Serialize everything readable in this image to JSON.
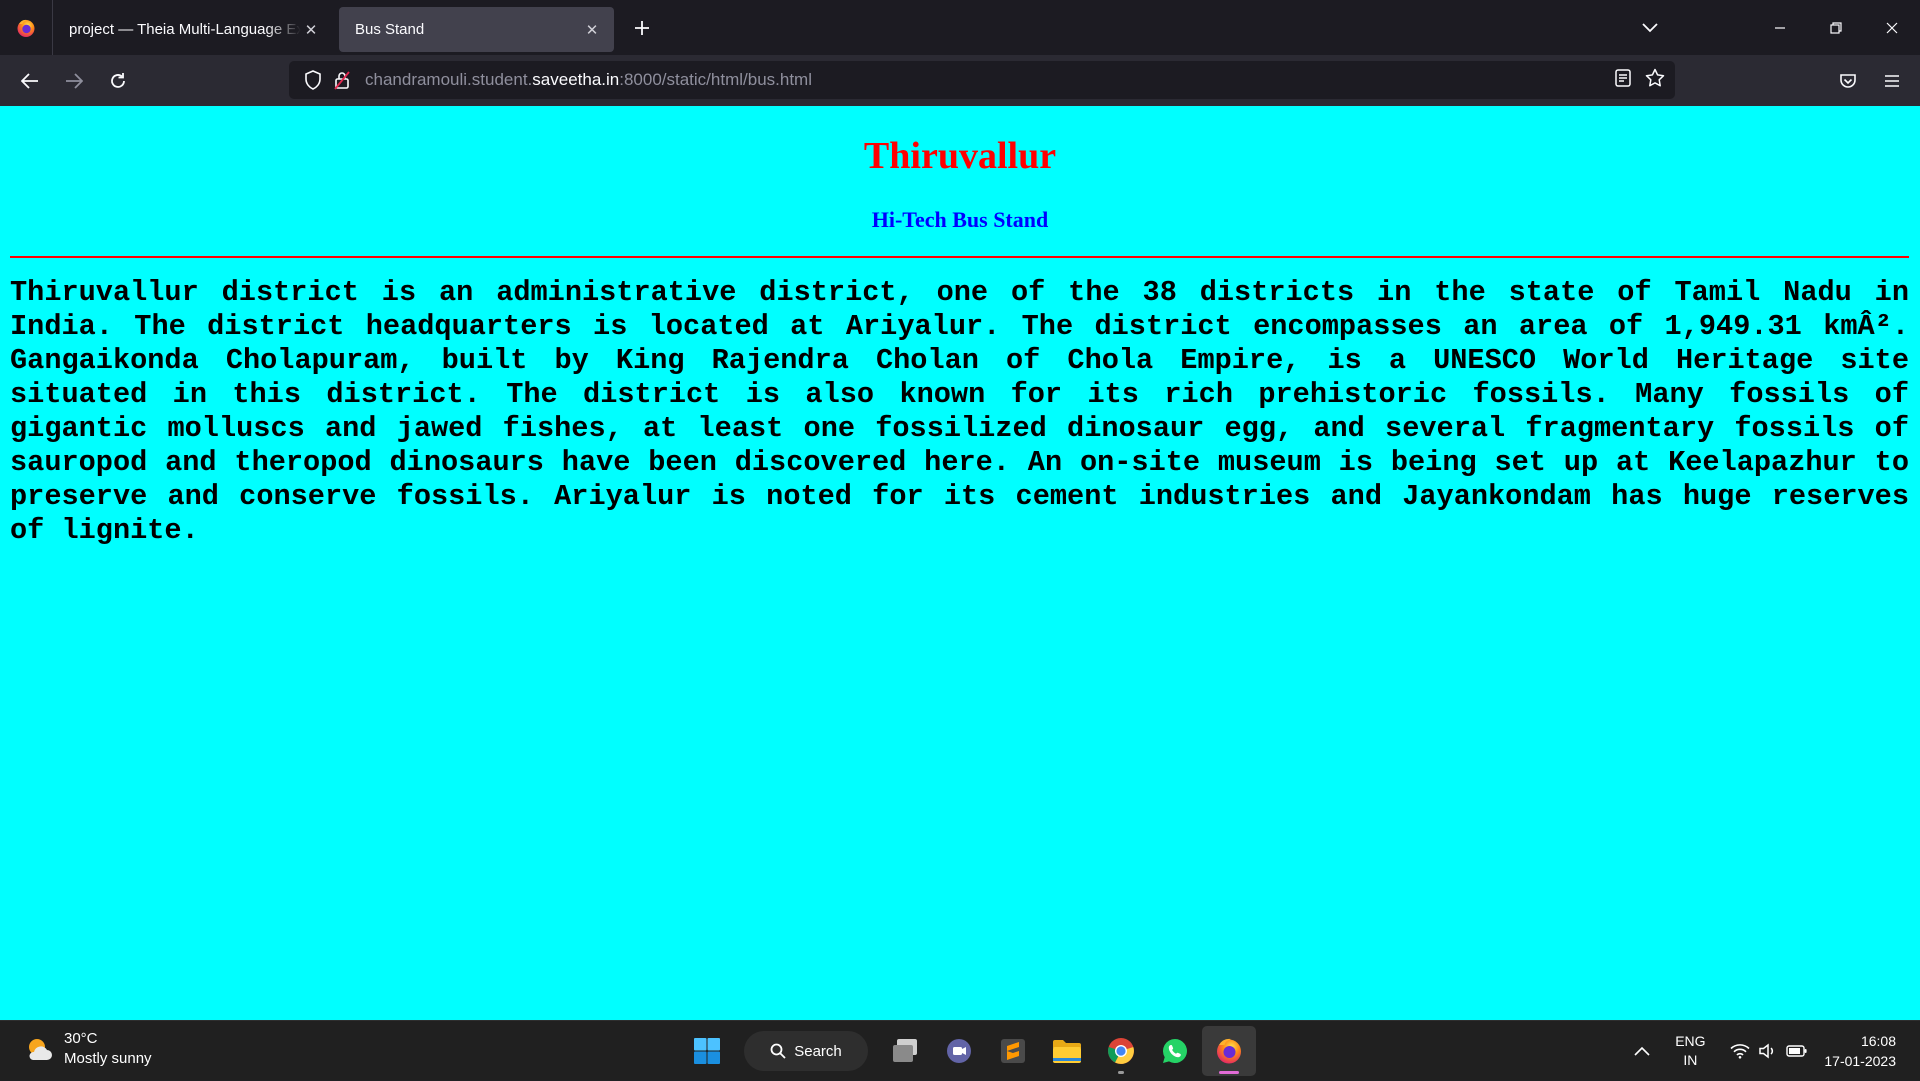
{
  "browser": {
    "tabs": [
      {
        "label": "project — Theia Multi-Language Ex",
        "active": false
      },
      {
        "label": "Bus Stand",
        "active": true
      }
    ],
    "url": {
      "prefix": "chandramouli.student.",
      "domain": "saveetha.in",
      "suffix": ":8000/static/html/bus.html"
    }
  },
  "page": {
    "title": "Thiruvallur",
    "subtitle": "Hi-Tech Bus Stand",
    "body": "Thiruvallur district is an administrative district, one of the 38 districts in the state of Tamil Nadu in India. The district headquarters is located at Ariyalur. The district encompasses an area of 1,949.31 kmÂ². Gangaikonda Cholapuram, built by King Rajendra Cholan of Chola Empire, is a UNESCO World Heritage site situated in this district. The district is also known for its rich prehistoric fossils. Many fossils of gigantic molluscs and jawed fishes, at least one fossilized dinosaur egg, and several fragmentary fossils of sauropod and theropod dinosaurs have been discovered here. An on-site museum is being set up at Keelapazhur to preserve and conserve fossils. Ariyalur is noted for its cement industries and Jayankondam has huge reserves of lignite.",
    "colors": {
      "background": "#00ffff",
      "title": "#ff0000",
      "subtitle": "#0000ff",
      "rule": "#ff0000"
    }
  },
  "taskbar": {
    "weather": {
      "temp": "30°C",
      "condition": "Mostly sunny"
    },
    "search_label": "Search",
    "apps": [
      "task-view-icon",
      "teams-chat-icon",
      "sublime-text-icon",
      "file-explorer-icon",
      "chrome-icon",
      "whatsapp-icon",
      "firefox-icon"
    ],
    "tray": {
      "lang_top": "ENG",
      "lang_bottom": "IN",
      "time": "16:08",
      "date": "17-01-2023"
    }
  }
}
